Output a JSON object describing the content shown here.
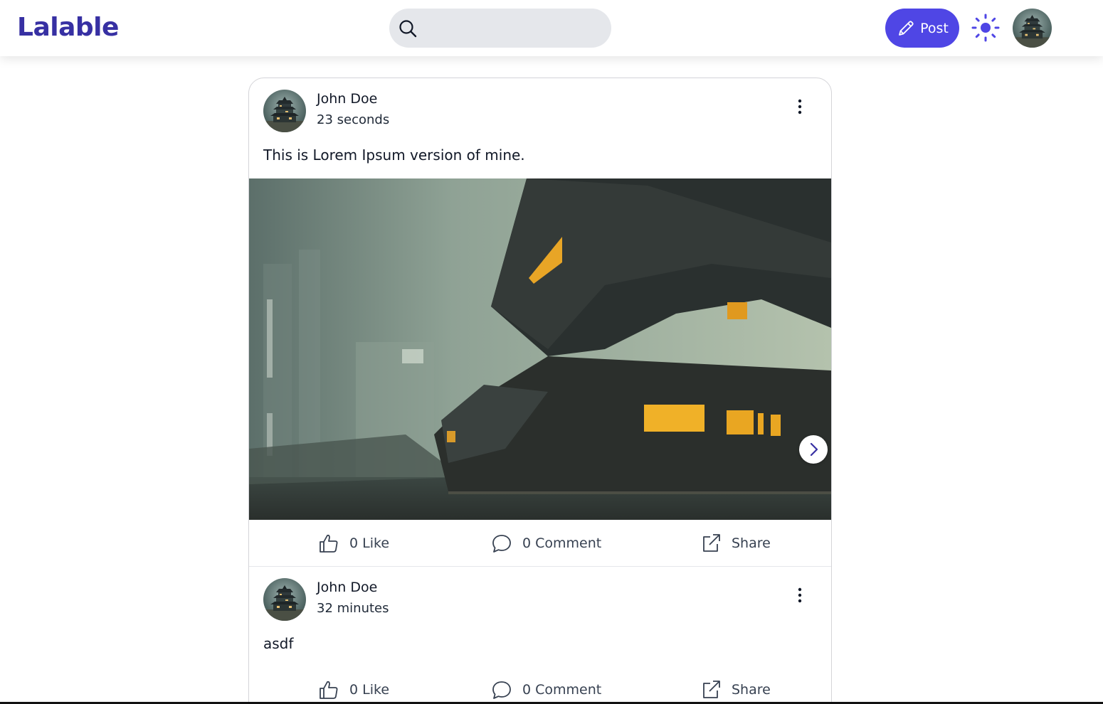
{
  "app": {
    "logo": "Lalable",
    "accent_color": "#4f46e5",
    "logo_color": "#3730a3"
  },
  "header": {
    "search": {
      "icon": "search-icon",
      "placeholder": "",
      "value": ""
    },
    "post_button": {
      "label": "Post",
      "icon": "pencil-icon"
    },
    "theme_toggle": {
      "icon": "sun-icon"
    },
    "profile": {
      "icon": "avatar"
    }
  },
  "posts": [
    {
      "author": "John Doe",
      "time": "23 seconds",
      "text": "This is Lorem Ipsum version of mine.",
      "has_image": true,
      "actions": {
        "like": "0 Like",
        "comment": "0 Comment",
        "share": "Share"
      }
    },
    {
      "author": "John Doe",
      "time": "32 minutes",
      "text": "asdf",
      "has_image": false,
      "actions": {
        "like": "0 Like",
        "comment": "0 Comment",
        "share": "Share"
      }
    }
  ]
}
